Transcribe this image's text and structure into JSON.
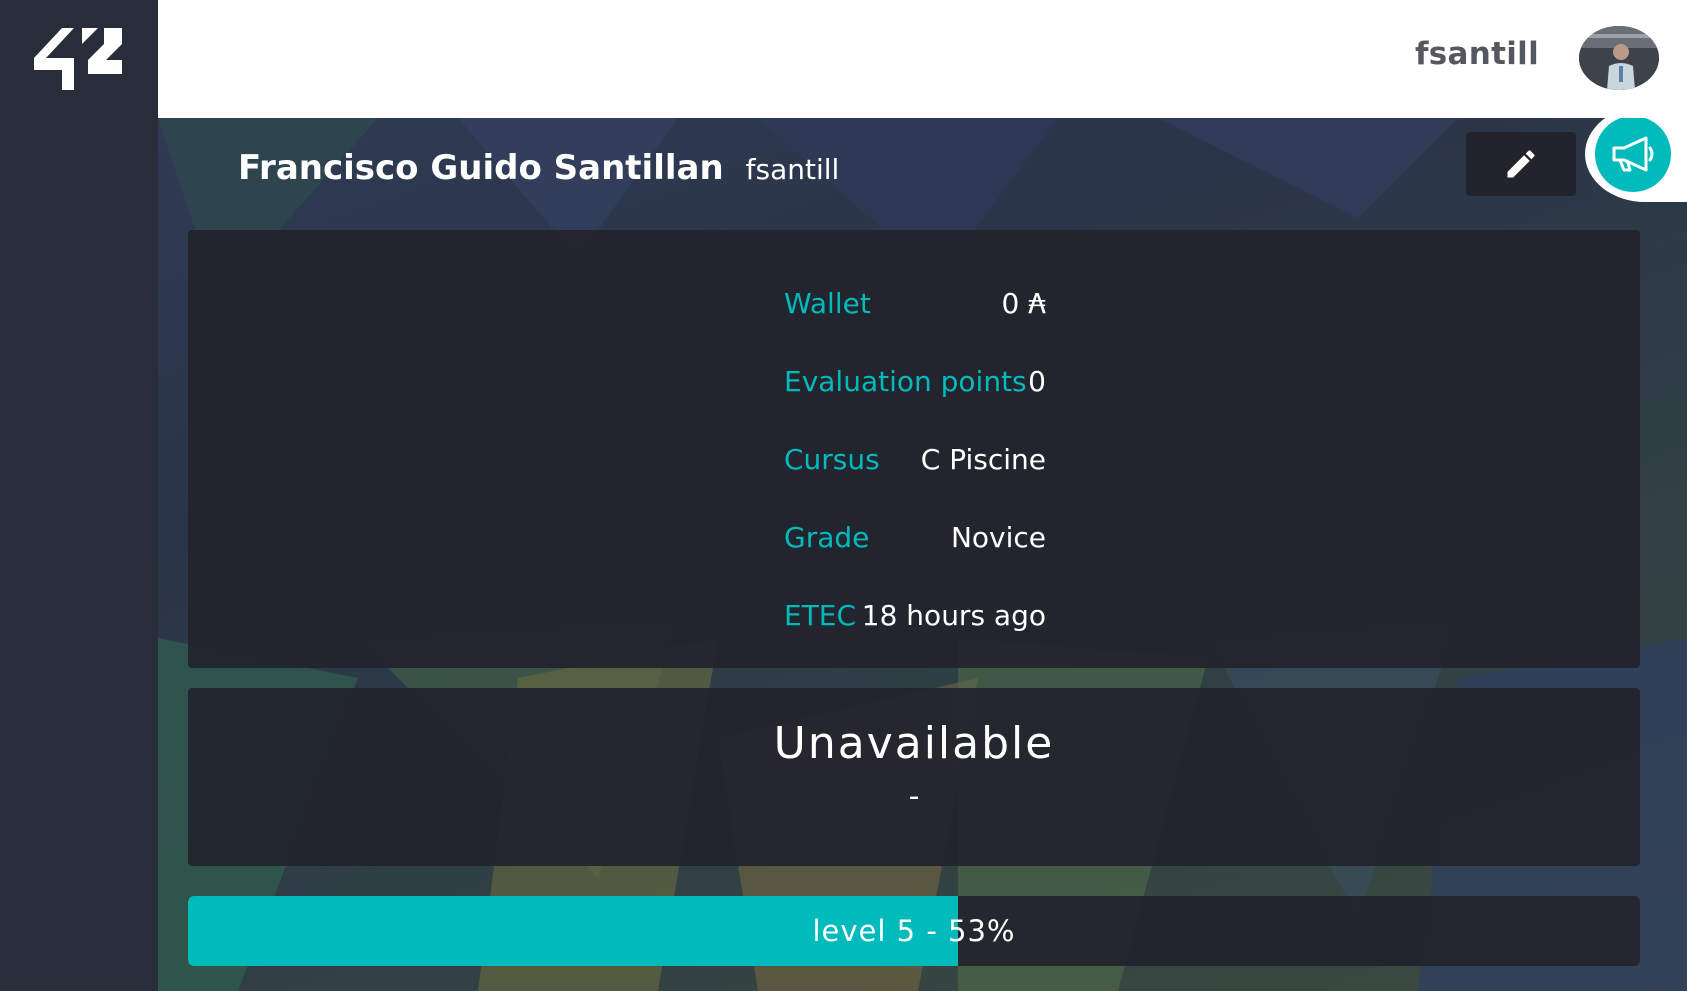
{
  "brand": {
    "logo_text": "42"
  },
  "header": {
    "username": "fsantill"
  },
  "profile": {
    "full_name": "Francisco Guido Santillan",
    "login": "fsantill",
    "info": [
      {
        "label": "Wallet",
        "value": "0 ₳"
      },
      {
        "label": "Evaluation points",
        "value": "0"
      },
      {
        "label": "Cursus",
        "value": "C Piscine"
      },
      {
        "label": "Grade",
        "value": "Novice"
      },
      {
        "label": "ETEC",
        "value": "18 hours ago"
      }
    ],
    "status": {
      "title": "Unavailable",
      "subtitle": "-"
    },
    "level": {
      "label": "level 5 - 53%",
      "progress_percent": 53
    }
  },
  "colors": {
    "accent": "#00babc",
    "sidebar": "#292d39",
    "panel": "#22232c",
    "text_light": "#ffffff",
    "username_dark": "#55585e"
  },
  "icons": {
    "edit": "pencil-icon",
    "announce": "megaphone-icon",
    "logo": "42-logo"
  }
}
